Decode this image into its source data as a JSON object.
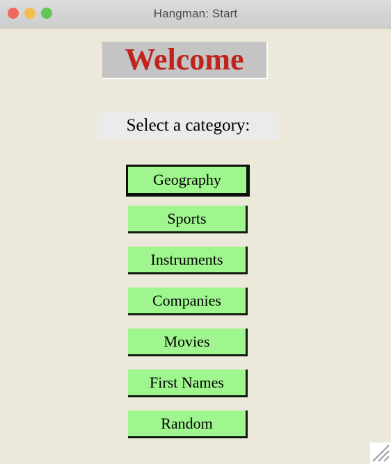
{
  "window": {
    "title": "Hangman: Start",
    "controls": [
      {
        "name": "close",
        "color": "#ee6a5f"
      },
      {
        "name": "minimize",
        "color": "#f5bd4f"
      },
      {
        "name": "zoom",
        "color": "#61c454"
      }
    ]
  },
  "main": {
    "heading": "Welcome",
    "heading_color": "#c0221c",
    "heading_bg": "#c4c4c4",
    "prompt": "Select a category:",
    "prompt_bg": "#ebebeb",
    "background": "#ece8da",
    "button_color": "#9ff58e",
    "buttons": [
      {
        "label": "Geography",
        "focused": true
      },
      {
        "label": "Sports",
        "focused": false
      },
      {
        "label": "Instruments",
        "focused": false
      },
      {
        "label": "Companies",
        "focused": false
      },
      {
        "label": "Movies",
        "focused": false
      },
      {
        "label": "First Names",
        "focused": false
      },
      {
        "label": "Random",
        "focused": false
      }
    ]
  }
}
